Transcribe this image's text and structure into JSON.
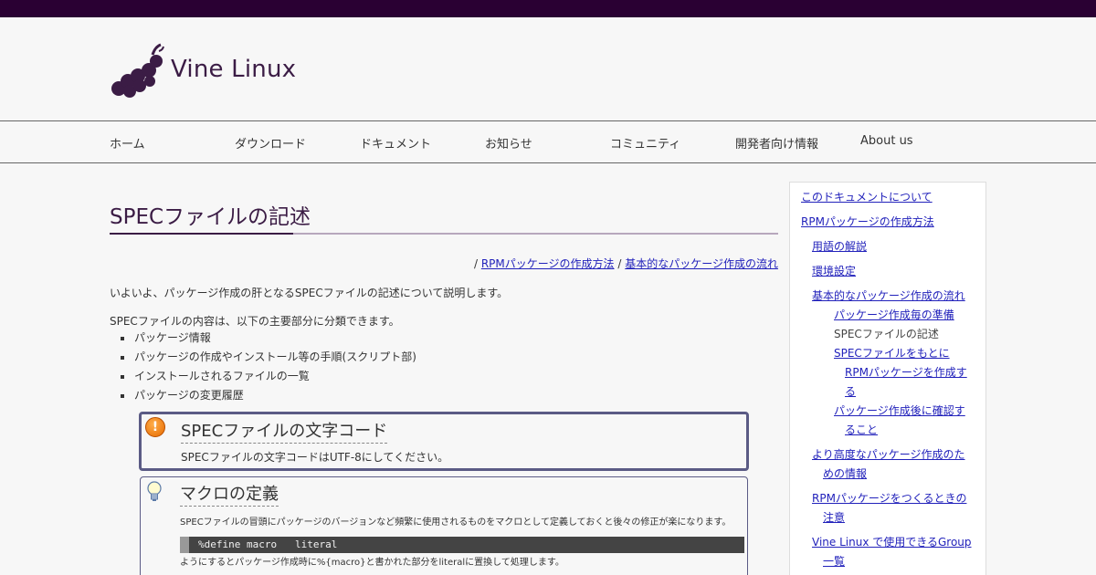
{
  "site": {
    "name": "Vine Linux",
    "logo_icon": "grape-cluster-icon",
    "colors": {
      "topbar": "#2a0033",
      "brand": "#3b1c45",
      "link": "#2222bb"
    }
  },
  "nav": {
    "items": [
      "ホーム",
      "ダウンロード",
      "ドキュメント",
      "お知らせ",
      "コミュニティ",
      "開発者向け情報",
      "About us"
    ]
  },
  "page": {
    "title": "SPECファイルの記述",
    "breadcrumb": {
      "separator": "/",
      "links": [
        "RPMパッケージの作成方法",
        "基本的なパッケージ作成の流れ"
      ]
    },
    "intro": "いよいよ、パッケージ作成の肝となるSPECファイルの記述について説明します。",
    "parts_intro": "SPECファイルの内容は、以下の主要部分に分類できます。",
    "parts": [
      "パッケージ情報",
      "パッケージの作成やインストール等の手順(スクリプト部)",
      "インストールされるファイルの一覧",
      "パッケージの変更履歴"
    ],
    "note_warning": {
      "icon": "warning-icon",
      "heading": "SPECファイルの文字コード",
      "body": "SPECファイルの文字コードはUTF-8にしてください。"
    },
    "note_tip": {
      "icon": "lightbulb-icon",
      "heading": "マクロの定義",
      "body": "SPECファイルの冒頭にパッケージのバージョンなど頻繁に使用されるものをマクロとして定義しておくと後々の修正が楽になります。",
      "code": "%define macro   literal",
      "after": "ようにするとパッケージ作成時に%{macro}と書かれた部分をliteralに置換して処理します。"
    }
  },
  "sidebar": {
    "items": [
      "このドキュメントについて",
      "RPMパッケージの作成方法",
      "用語の解説",
      "環境設定",
      "基本的なパッケージ作成の流れ",
      "パッケージ作成毎の準備",
      "SPECファイルの記述",
      "SPECファイルをもとに",
      "RPMパッケージを作成す",
      "る",
      "パッケージ作成後に確認す",
      "ること",
      "より高度なパッケージ作成のた",
      "めの情報",
      "RPMパッケージをつくるときの",
      "注意",
      "Vine Linux で使用できるGroup",
      "一覧"
    ]
  }
}
